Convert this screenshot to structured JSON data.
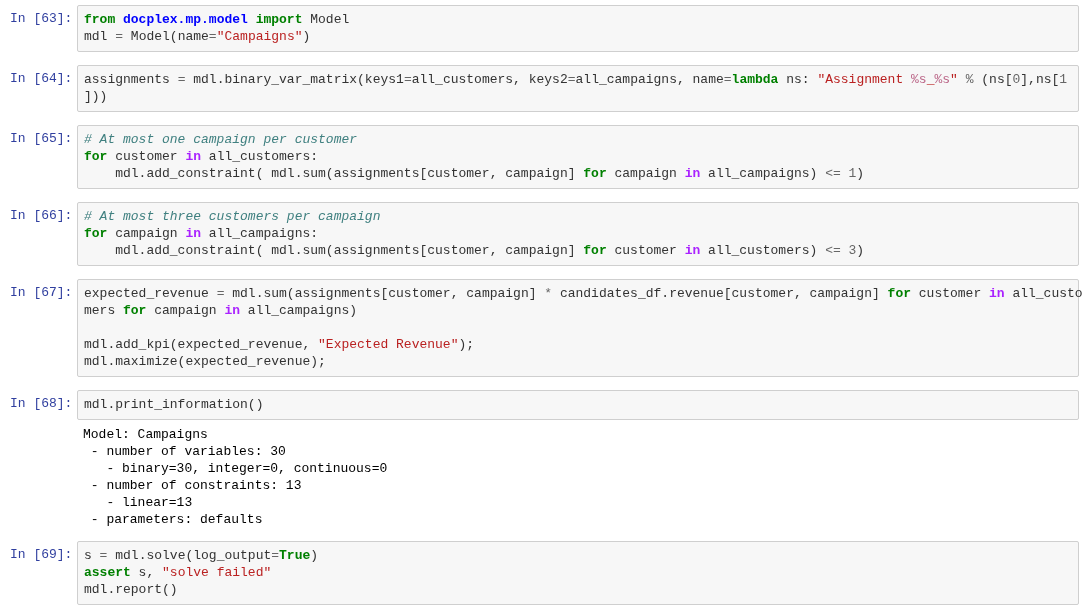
{
  "cells": [
    {
      "prompt": "In [63]:",
      "code": [
        {
          "tokens": [
            {
              "kind": "kw",
              "t": "from "
            },
            {
              "kind": "mod",
              "t": "docplex.mp.model "
            },
            {
              "kind": "kw",
              "t": "import"
            },
            {
              "kind": "plain",
              "t": " Model"
            }
          ]
        },
        {
          "tokens": [
            {
              "kind": "plain",
              "t": "mdl "
            },
            {
              "kind": "op",
              "t": "="
            },
            {
              "kind": "plain",
              "t": " Model(name"
            },
            {
              "kind": "op",
              "t": "="
            },
            {
              "kind": "str",
              "t": "\"Campaigns\""
            },
            {
              "kind": "plain",
              "t": ")"
            }
          ]
        }
      ]
    },
    {
      "prompt": "In [64]:",
      "code": [
        {
          "tokens": [
            {
              "kind": "plain",
              "t": "assignments "
            },
            {
              "kind": "op",
              "t": "="
            },
            {
              "kind": "plain",
              "t": " mdl.binary_var_matrix(keys1"
            },
            {
              "kind": "op",
              "t": "="
            },
            {
              "kind": "plain",
              "t": "all_customers, keys2"
            },
            {
              "kind": "op",
              "t": "="
            },
            {
              "kind": "plain",
              "t": "all_campaigns, name"
            },
            {
              "kind": "op",
              "t": "="
            },
            {
              "kind": "kw",
              "t": "lambda"
            },
            {
              "kind": "plain",
              "t": " ns: "
            },
            {
              "kind": "str",
              "t": "\"Assignment "
            },
            {
              "kind": "interp",
              "t": "%s"
            },
            {
              "kind": "str",
              "t": "_"
            },
            {
              "kind": "interp",
              "t": "%s"
            },
            {
              "kind": "str",
              "t": "\""
            },
            {
              "kind": "op",
              "t": " %"
            },
            {
              "kind": "plain",
              "t": " (ns["
            },
            {
              "kind": "num",
              "t": "0"
            },
            {
              "kind": "plain",
              "t": "],ns["
            },
            {
              "kind": "num",
              "t": "1"
            }
          ]
        },
        {
          "tokens": [
            {
              "kind": "plain",
              "t": "]))"
            }
          ]
        }
      ]
    },
    {
      "prompt": "In [65]:",
      "code": [
        {
          "tokens": [
            {
              "kind": "comment",
              "t": "# At most one campaign per customer"
            }
          ]
        },
        {
          "tokens": [
            {
              "kind": "kw",
              "t": "for"
            },
            {
              "kind": "plain",
              "t": " customer "
            },
            {
              "kind": "opword",
              "t": "in"
            },
            {
              "kind": "plain",
              "t": " all_customers:"
            }
          ]
        },
        {
          "tokens": [
            {
              "kind": "plain",
              "t": "    mdl.add_constraint( mdl.sum(assignments[customer, campaign] "
            },
            {
              "kind": "kw",
              "t": "for"
            },
            {
              "kind": "plain",
              "t": " campaign "
            },
            {
              "kind": "opword",
              "t": "in"
            },
            {
              "kind": "plain",
              "t": " all_campaigns) "
            },
            {
              "kind": "op",
              "t": "<= "
            },
            {
              "kind": "num",
              "t": "1"
            },
            {
              "kind": "plain",
              "t": ")"
            }
          ]
        }
      ]
    },
    {
      "prompt": "In [66]:",
      "code": [
        {
          "tokens": [
            {
              "kind": "comment",
              "t": "# At most three customers per campaign"
            }
          ]
        },
        {
          "tokens": [
            {
              "kind": "kw",
              "t": "for"
            },
            {
              "kind": "plain",
              "t": " campaign "
            },
            {
              "kind": "opword",
              "t": "in"
            },
            {
              "kind": "plain",
              "t": " all_campaigns:"
            }
          ]
        },
        {
          "tokens": [
            {
              "kind": "plain",
              "t": "    mdl.add_constraint( mdl.sum(assignments[customer, campaign] "
            },
            {
              "kind": "kw",
              "t": "for"
            },
            {
              "kind": "plain",
              "t": " customer "
            },
            {
              "kind": "opword",
              "t": "in"
            },
            {
              "kind": "plain",
              "t": " all_customers) "
            },
            {
              "kind": "op",
              "t": "<= "
            },
            {
              "kind": "num",
              "t": "3"
            },
            {
              "kind": "plain",
              "t": ")"
            }
          ]
        }
      ]
    },
    {
      "prompt": "In [67]:",
      "code": [
        {
          "tokens": [
            {
              "kind": "plain",
              "t": "expected_revenue "
            },
            {
              "kind": "op",
              "t": "="
            },
            {
              "kind": "plain",
              "t": " mdl.sum(assignments[customer, campaign] "
            },
            {
              "kind": "op",
              "t": "*"
            },
            {
              "kind": "plain",
              "t": " candidates_df.revenue[customer, campaign] "
            },
            {
              "kind": "kw",
              "t": "for"
            },
            {
              "kind": "plain",
              "t": " customer "
            },
            {
              "kind": "opword",
              "t": "in"
            },
            {
              "kind": "plain",
              "t": " all_custo"
            }
          ]
        },
        {
          "tokens": [
            {
              "kind": "plain",
              "t": "mers "
            },
            {
              "kind": "kw",
              "t": "for"
            },
            {
              "kind": "plain",
              "t": " campaign "
            },
            {
              "kind": "opword",
              "t": "in"
            },
            {
              "kind": "plain",
              "t": " all_campaigns)"
            }
          ]
        },
        {
          "space_before": true,
          "tokens": [
            {
              "kind": "plain",
              "t": "mdl.add_kpi(expected_revenue, "
            },
            {
              "kind": "str",
              "t": "\"Expected Revenue\""
            },
            {
              "kind": "plain",
              "t": ");"
            }
          ]
        },
        {
          "tokens": [
            {
              "kind": "plain",
              "t": "mdl.maximize(expected_revenue);"
            }
          ]
        }
      ]
    },
    {
      "prompt": "In [68]:",
      "code": [
        {
          "tokens": [
            {
              "kind": "plain",
              "t": "mdl.print_information()"
            }
          ]
        }
      ],
      "output": [
        "Model: Campaigns",
        " - number of variables: 30",
        "   - binary=30, integer=0, continuous=0",
        " - number of constraints: 13",
        "   - linear=13",
        " - parameters: defaults"
      ]
    },
    {
      "prompt": "In [69]:",
      "code": [
        {
          "tokens": [
            {
              "kind": "plain",
              "t": "s "
            },
            {
              "kind": "op",
              "t": "="
            },
            {
              "kind": "plain",
              "t": " mdl.solve(log_output"
            },
            {
              "kind": "op",
              "t": "="
            },
            {
              "kind": "kw",
              "t": "True"
            },
            {
              "kind": "plain",
              "t": ")"
            }
          ]
        },
        {
          "tokens": [
            {
              "kind": "kw",
              "t": "assert"
            },
            {
              "kind": "plain",
              "t": " s, "
            },
            {
              "kind": "str",
              "t": "\"solve failed\""
            }
          ]
        },
        {
          "tokens": [
            {
              "kind": "plain",
              "t": "mdl.report()"
            }
          ]
        }
      ]
    }
  ]
}
